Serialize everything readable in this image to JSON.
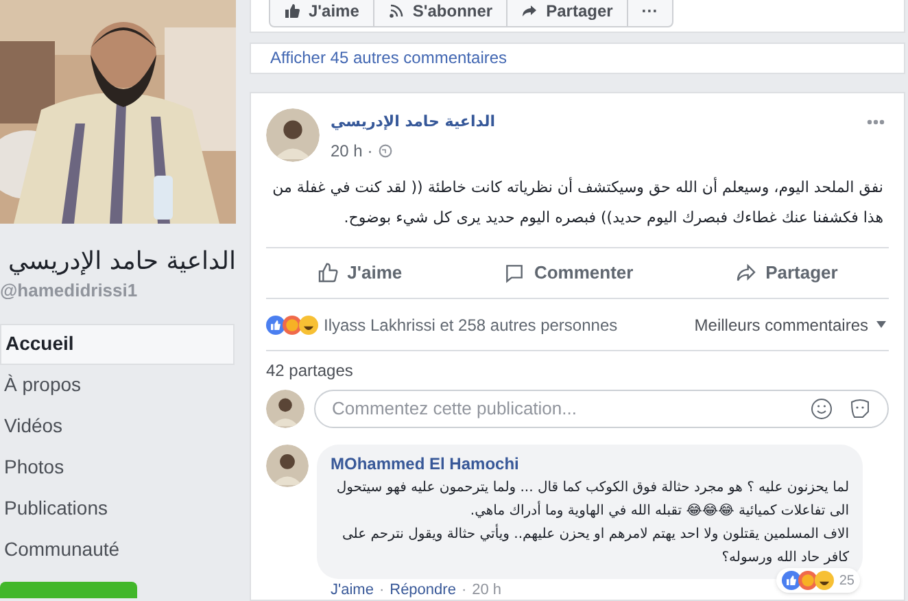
{
  "sidebar": {
    "page_name": "الداعية حامد الإدريسي",
    "handle": "@hamedidrissi1",
    "nav": [
      {
        "label": "Accueil",
        "selected": true
      },
      {
        "label": "À propos",
        "selected": false
      },
      {
        "label": "Vidéos",
        "selected": false
      },
      {
        "label": "Photos",
        "selected": false
      },
      {
        "label": "Publications",
        "selected": false
      },
      {
        "label": "Communauté",
        "selected": false
      }
    ]
  },
  "page_actions": [
    {
      "kind": "like",
      "label": "J'aime"
    },
    {
      "kind": "follow",
      "label": "S'abonner"
    },
    {
      "kind": "share",
      "label": "Partager"
    },
    {
      "kind": "more",
      "label": "···"
    }
  ],
  "more_comments": "Afficher 45 autres commentaires",
  "post": {
    "author": "الداعية حامد الإدريسي",
    "time": "20 h ·",
    "text": "نفق الملحد اليوم، وسيعلم أن الله حق وسيكتشف أن نظرياته كانت خاطئة (( لقد كنت في غفلة من هذا فكشفنا عنك غطاءك فبصرك اليوم حديد)) فبصره اليوم حديد يرى كل شيء بوضوح.",
    "actions": [
      {
        "kind": "like",
        "label": "J'aime"
      },
      {
        "kind": "comment",
        "label": "Commenter"
      },
      {
        "kind": "share",
        "label": "Partager"
      }
    ],
    "reactions": "Ilyass Lakhrissi et 258 autres personnes",
    "sort": "Meilleurs commentaires",
    "shares": "42 partages",
    "comment_placeholder": "Commentez cette publication...",
    "comments": [
      {
        "author": "MOhammed El Hamochi",
        "text": "لما يحزنون عليه ؟ هو مجرد حثالة فوق الكوكب كما قال ... ولما يترحمون عليه فهو سيتحول الى تفاعلات كميائية 😂😂😂 تقبله الله في الهاوية وما أدراك ماهي.",
        "text_2": "الاف المسلمين يقتلون ولا احد يهتم لامرهم او يحزن عليهم.. ويأتي حثالة ويقول نترحم على كافر حاد الله ورسوله؟",
        "like": "J'aime",
        "separator": "·",
        "reply": "Répondre",
        "time": "20 h",
        "reaction_count": "25"
      }
    ]
  }
}
